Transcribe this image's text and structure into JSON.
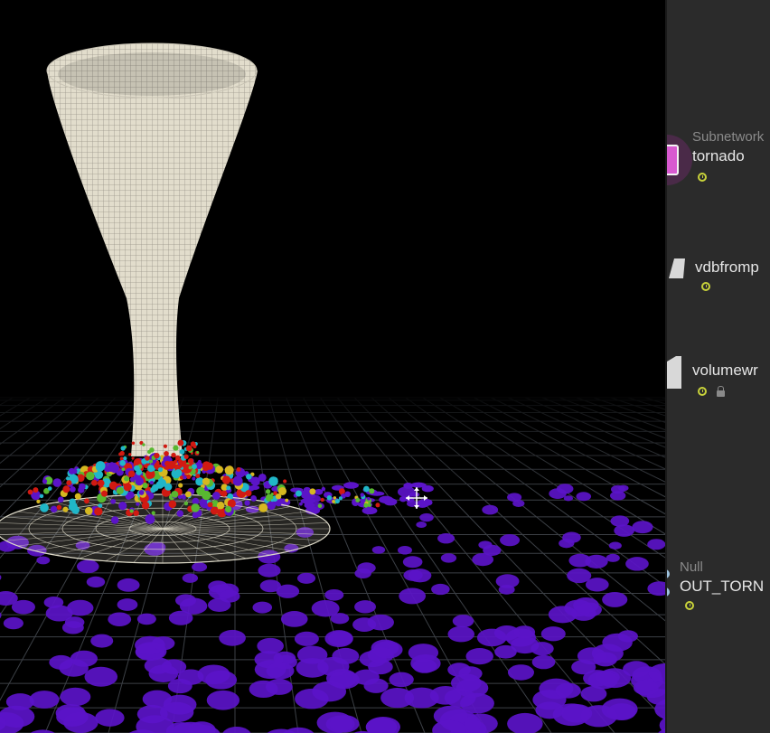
{
  "viewport": {
    "scene": "tornado-particle-simulation",
    "handle_icon": "move-cross-icon",
    "colors": {
      "background": "#000000",
      "funnel": "#ddd9c8",
      "grid": "#3c4046",
      "particle_primary": "#5b14c8",
      "particle_red": "#d11a12",
      "particle_cyan": "#20b6c8",
      "particle_green": "#58b830",
      "particle_yellow": "#d6b820"
    }
  },
  "network": {
    "background": "#2b2b2b",
    "nodes": [
      {
        "type": "Subnetwork",
        "name": "tornado",
        "icon": "subnetwork-icon",
        "icon_color": "#d85ad0",
        "flags": [
          "display-flag-icon"
        ]
      },
      {
        "type": "",
        "name": "vdbfromp",
        "icon": "vdb-node-icon",
        "icon_color": "#d8d8d8",
        "flags": [
          "display-flag-icon"
        ]
      },
      {
        "type": "",
        "name": "volumewr",
        "icon": "volume-node-icon",
        "icon_color": "#d8d8d8",
        "flags": [
          "display-flag-icon",
          "lock-icon"
        ]
      },
      {
        "type": "Null",
        "name": "OUT_TORN",
        "icon": "null-node-icon",
        "icon_color": "#9ec3e0",
        "flags": [
          "display-flag-icon"
        ]
      }
    ]
  }
}
